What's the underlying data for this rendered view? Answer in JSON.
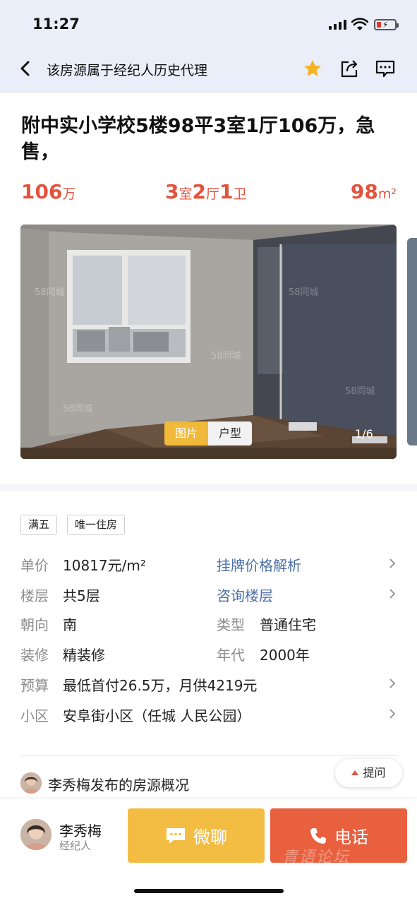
{
  "status_bar": {
    "time": "11:27"
  },
  "header": {
    "title": "该房源属于经纪人历史代理",
    "icons": [
      "back-icon",
      "star-icon",
      "share-icon",
      "message-icon"
    ],
    "star_color": "#f5b31f"
  },
  "listing": {
    "title": "附中实小学校5楼98平3室1厅106万，急售，",
    "price_num": "106",
    "price_unit": "万",
    "layout": {
      "rooms": "3",
      "rooms_unit": "室",
      "halls": "2",
      "halls_unit": "厅",
      "baths": "1",
      "baths_unit": "卫"
    },
    "area_num": "98",
    "area_unit": "m²",
    "accent": "#e2533d"
  },
  "gallery": {
    "tabs": [
      "图片",
      "户型"
    ],
    "active_tab": "图片",
    "counter": "1/6",
    "watermark": "58同城"
  },
  "tags": [
    "满五",
    "唯一住房"
  ],
  "info": {
    "unit_price_label": "单价",
    "unit_price_value": "10817元/m²",
    "price_analysis_link": "挂牌价格解析",
    "floor_label": "楼层",
    "floor_value": "共5层",
    "floor_consult_link": "咨询楼层",
    "orientation_label": "朝向",
    "orientation_value": "南",
    "type_label": "类型",
    "type_value": "普通住宅",
    "decoration_label": "装修",
    "decoration_value": "精装修",
    "year_label": "年代",
    "year_value": "2000年",
    "budget_label": "预算",
    "budget_value": "最低首付26.5万，月供4219元",
    "community_label": "小区",
    "community_value": "安阜街小区（任城 人民公园）"
  },
  "overview": {
    "title": "李秀梅发布的房源概况",
    "ask_label": "提问"
  },
  "agent": {
    "name": "李秀梅",
    "role": "经纪人",
    "chat_label": "微聊",
    "call_label": "电话",
    "chat_color": "#f3bd44",
    "call_color": "#e9603f",
    "watermark": "青语论坛"
  }
}
